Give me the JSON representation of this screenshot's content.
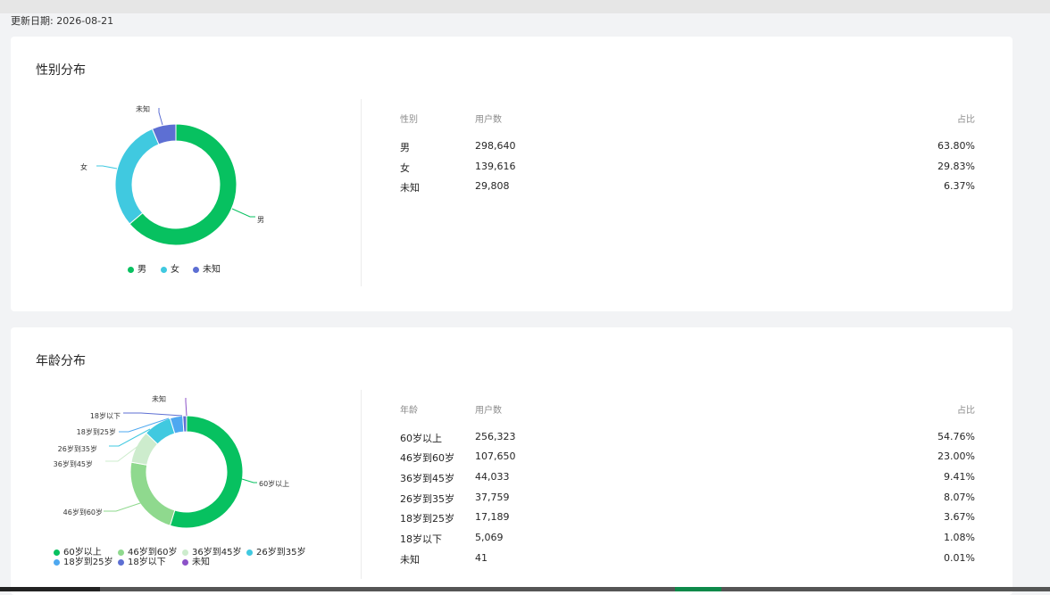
{
  "update_label": "更新日期:",
  "update_date": "2026-08-21",
  "gender": {
    "title": "性别分布",
    "headers": {
      "category": "性别",
      "users": "用户数",
      "ratio": "占比"
    },
    "rows": [
      {
        "label": "男",
        "users": "298,640",
        "ratio": "63.80%"
      },
      {
        "label": "女",
        "users": "139,616",
        "ratio": "29.83%"
      },
      {
        "label": "未知",
        "users": "29,808",
        "ratio": "6.37%"
      }
    ]
  },
  "age": {
    "title": "年龄分布",
    "headers": {
      "category": "年龄",
      "users": "用户数",
      "ratio": "占比"
    },
    "rows": [
      {
        "label": "60岁以上",
        "users": "256,323",
        "ratio": "54.76%"
      },
      {
        "label": "46岁到60岁",
        "users": "107,650",
        "ratio": "23.00%"
      },
      {
        "label": "36岁到45岁",
        "users": "44,033",
        "ratio": "9.41%"
      },
      {
        "label": "26岁到35岁",
        "users": "37,759",
        "ratio": "8.07%"
      },
      {
        "label": "18岁到25岁",
        "users": "17,189",
        "ratio": "3.67%"
      },
      {
        "label": "18岁以下",
        "users": "5,069",
        "ratio": "1.08%"
      },
      {
        "label": "未知",
        "users": "41",
        "ratio": "0.01%"
      }
    ]
  },
  "chart_data": [
    {
      "type": "pie",
      "categories": [
        "男",
        "女",
        "未知"
      ],
      "values": [
        63.8,
        29.83,
        6.37
      ],
      "colors": [
        "#07c160",
        "#40c9e0",
        "#5d6fd3"
      ],
      "legend": "bottom"
    },
    {
      "type": "pie",
      "categories": [
        "60岁以上",
        "46岁到60岁",
        "36岁到45岁",
        "26岁到35岁",
        "18岁到25岁",
        "18岁以下",
        "未知"
      ],
      "values": [
        54.76,
        23.0,
        9.41,
        8.07,
        3.67,
        1.08,
        0.01
      ],
      "colors": [
        "#07c160",
        "#8fd98e",
        "#cdeccd",
        "#40c9e0",
        "#4ea8f0",
        "#5d6fd3",
        "#8c52c8"
      ],
      "legend": "bottom"
    }
  ]
}
